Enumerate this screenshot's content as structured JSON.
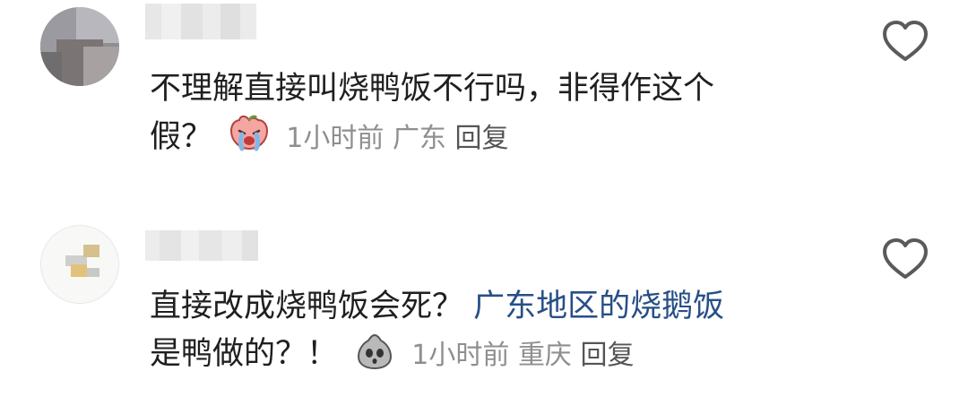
{
  "comments": [
    {
      "line1": "不理解直接叫烧鸭饭不行吗，非得作这个",
      "line2": "假？",
      "emoji": "crying-peach-emoji",
      "time": "1小时前",
      "location": "广东",
      "reply": "回复"
    },
    {
      "line1_main": "直接改成烧鸭饭会死？",
      "line1_link": "广东地区的烧鹅饭",
      "line2": "是鸭做的？！",
      "emoji": "shocked-gray-blob-emoji",
      "time": "1小时前",
      "location": "重庆",
      "reply": "回复"
    }
  ],
  "colors": {
    "text": "#1f1f1f",
    "meta": "#8f8f8f",
    "link": "#274f86",
    "heart": "#5a5a5a"
  }
}
